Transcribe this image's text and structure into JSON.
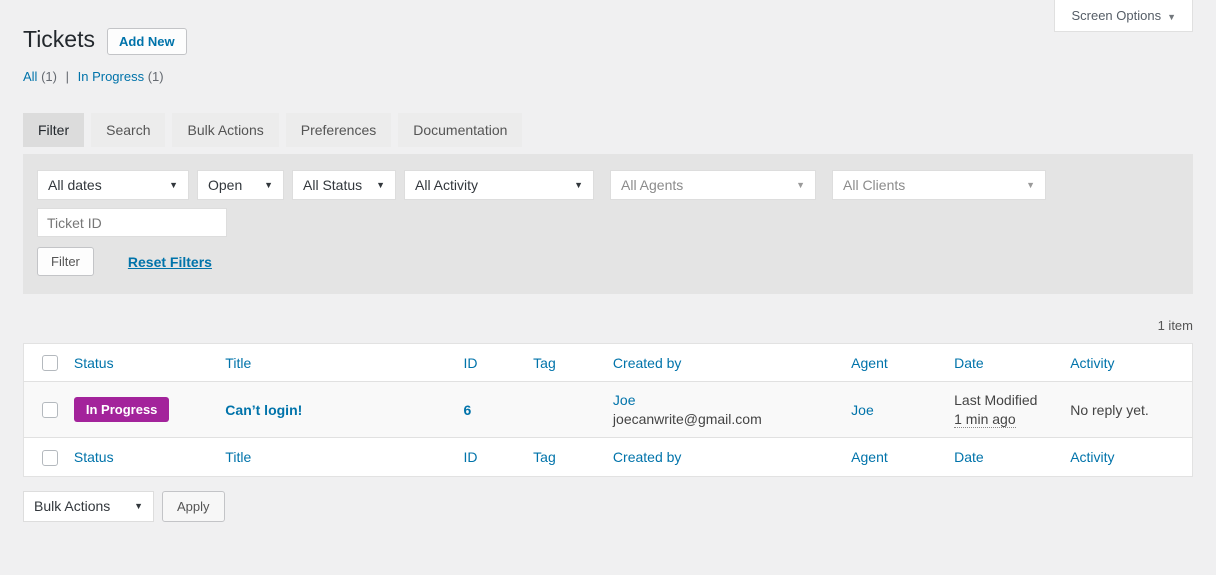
{
  "screen_options": {
    "label": "Screen Options",
    "arrow_icon": "▼"
  },
  "header": {
    "title": "Tickets",
    "add_new_label": "Add New"
  },
  "views": {
    "all_label": "All",
    "all_count": "(1)",
    "separator": "|",
    "in_progress_label": "In Progress",
    "in_progress_count": "(1)"
  },
  "tabs": [
    "Filter",
    "Search",
    "Bulk Actions",
    "Preferences",
    "Documentation"
  ],
  "filters": {
    "dates": "All dates",
    "open": "Open",
    "status": "All Status",
    "activity": "All Activity",
    "agents": "All Agents",
    "clients": "All Clients",
    "dropdown_arrow_icon": "▼",
    "ticket_id_placeholder": "Ticket ID",
    "filter_button": "Filter",
    "reset_link": "Reset Filters"
  },
  "item_count": "1 item",
  "table": {
    "columns": [
      "Status",
      "Title",
      "ID",
      "Tag",
      "Created by",
      "Agent",
      "Date",
      "Activity"
    ],
    "row": {
      "status": "In Progress",
      "title": "Can’t login!",
      "id": "6",
      "tag": "",
      "created_by_name": "Joe",
      "created_by_email": "joecanwrite@gmail.com",
      "agent": "Joe",
      "date_line1": "Last Modified",
      "date_line2": "1 min ago",
      "activity": "No reply yet."
    }
  },
  "bulk": {
    "select_value": "Bulk Actions",
    "apply_label": "Apply",
    "arrow_icon": "▼"
  },
  "colors": {
    "link_accent": "#0073aa",
    "status_in_progress_bg": "#a3239b",
    "panel_bg": "#e4e4e4"
  }
}
